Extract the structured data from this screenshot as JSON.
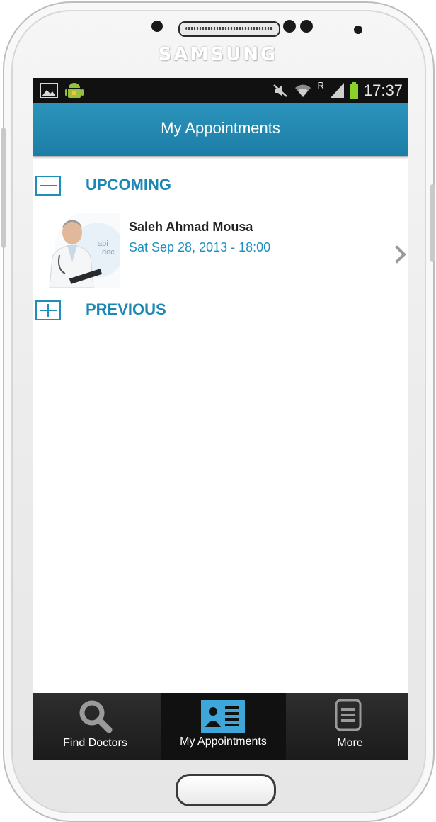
{
  "device": {
    "brand": "SAMSUNG"
  },
  "status_bar": {
    "time": "17:37",
    "network_label": "R"
  },
  "header": {
    "title": "My Appointments"
  },
  "sections": {
    "upcoming": {
      "label": "UPCOMING",
      "expanded": true
    },
    "previous": {
      "label": "PREVIOUS",
      "expanded": false
    }
  },
  "appointment": {
    "name": "Saleh Ahmad Mousa",
    "datetime": "Sat Sep 28, 2013 - 18:00",
    "logo_text_line1": "abi",
    "logo_text_line2": "doc"
  },
  "tabs": [
    {
      "label": "Find Doctors",
      "icon": "search-icon",
      "active": false
    },
    {
      "label": "My Appointments",
      "icon": "appointments-icon",
      "active": true
    },
    {
      "label": "More",
      "icon": "menu-icon",
      "active": false
    }
  ],
  "colors": {
    "accent": "#1c87b3",
    "header": "#2289b2",
    "tabbar": "#222222",
    "link": "#1c8fc0"
  }
}
